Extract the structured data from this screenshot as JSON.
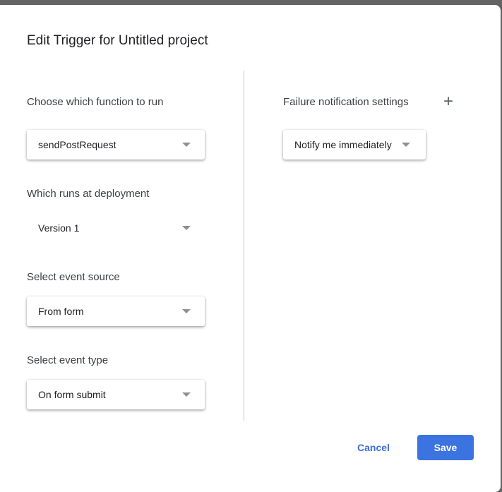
{
  "dialog": {
    "title": "Edit Trigger for Untitled project"
  },
  "left": {
    "function": {
      "label": "Choose which function to run",
      "value": "sendPostRequest"
    },
    "deployment": {
      "label": "Which runs at deployment",
      "value": "Version 1"
    },
    "source": {
      "label": "Select event source",
      "value": "From form"
    },
    "type": {
      "label": "Select event type",
      "value": "On form submit"
    }
  },
  "right": {
    "failure": {
      "label": "Failure notification settings",
      "value": "Notify me immediately",
      "add_icon": "plus-icon"
    }
  },
  "footer": {
    "cancel": "Cancel",
    "save": "Save"
  },
  "colors": {
    "accent": "#3b73e0"
  }
}
